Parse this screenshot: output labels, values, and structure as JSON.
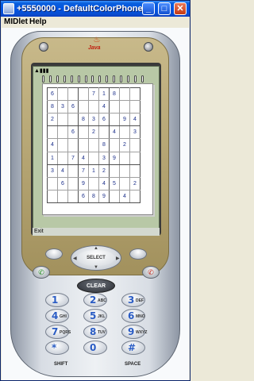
{
  "window": {
    "title": "+5550000 - DefaultColorPhone",
    "buttons": {
      "minimize": "_",
      "maximize": "□",
      "close": "✕"
    }
  },
  "menubar": {
    "items": [
      "MIDlet",
      "Help"
    ]
  },
  "phone": {
    "brand": "Java",
    "screen": {
      "softkey_left": "Exit",
      "sudoku": [
        [
          "6",
          "",
          "",
          "",
          "7",
          "1",
          "8",
          "",
          ""
        ],
        [
          "8",
          "3",
          "6",
          "",
          "",
          "4",
          "",
          "",
          ""
        ],
        [
          "2",
          "",
          "",
          "8",
          "3",
          "6",
          "",
          "9",
          "4"
        ],
        [
          "",
          "",
          "6",
          "",
          "2",
          "",
          "4",
          "",
          "3"
        ],
        [
          "4",
          "",
          "",
          "",
          "",
          "8",
          "",
          "2",
          ""
        ],
        [
          "1",
          "",
          "7",
          "4",
          "",
          "3",
          "9",
          "",
          ""
        ],
        [
          "3",
          "4",
          "",
          "7",
          "1",
          "2",
          "",
          "",
          ""
        ],
        [
          "",
          "6",
          "",
          "9",
          "",
          "4",
          "5",
          "",
          "2"
        ],
        [
          "",
          "",
          "",
          "6",
          "8",
          "9",
          "",
          "4",
          ""
        ]
      ]
    },
    "keys": {
      "select": "SELECT",
      "clear": "CLEAR",
      "call_symbol": "✆",
      "end_symbol": "✆",
      "arrows": {
        "up": "▲",
        "down": "▼",
        "left": "◀",
        "right": "▶"
      },
      "keypad": [
        {
          "num": "1",
          "sub": ""
        },
        {
          "num": "2",
          "sub": "ABC"
        },
        {
          "num": "3",
          "sub": "DEF"
        },
        {
          "num": "4",
          "sub": "GHI"
        },
        {
          "num": "5",
          "sub": "JKL"
        },
        {
          "num": "6",
          "sub": "MNO"
        },
        {
          "num": "7",
          "sub": "PQRS"
        },
        {
          "num": "8",
          "sub": "TUV"
        },
        {
          "num": "9",
          "sub": "WXYZ"
        },
        {
          "num": "*",
          "sub": ""
        },
        {
          "num": "0",
          "sub": ""
        },
        {
          "num": "#",
          "sub": ""
        }
      ],
      "shift_label": "SHIFT",
      "space_label": "SPACE"
    }
  }
}
